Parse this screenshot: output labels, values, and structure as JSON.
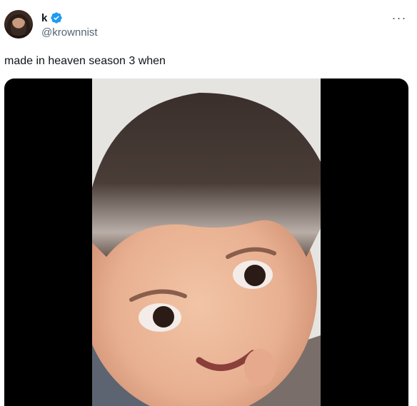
{
  "author": {
    "display_name": "k",
    "handle": "@krownnist",
    "verified": true,
    "avatar_icon": "profile-avatar"
  },
  "more_icon": "more-horizontal-icon",
  "more_label": "···",
  "tweet": {
    "text": "made in heaven season 3 when"
  },
  "media": {
    "type": "video",
    "icon": "video-thumbnail"
  },
  "colors": {
    "text_primary": "#0f1419",
    "text_secondary": "#536471",
    "verified_blue": "#1d9bf0",
    "media_background": "#000000"
  }
}
